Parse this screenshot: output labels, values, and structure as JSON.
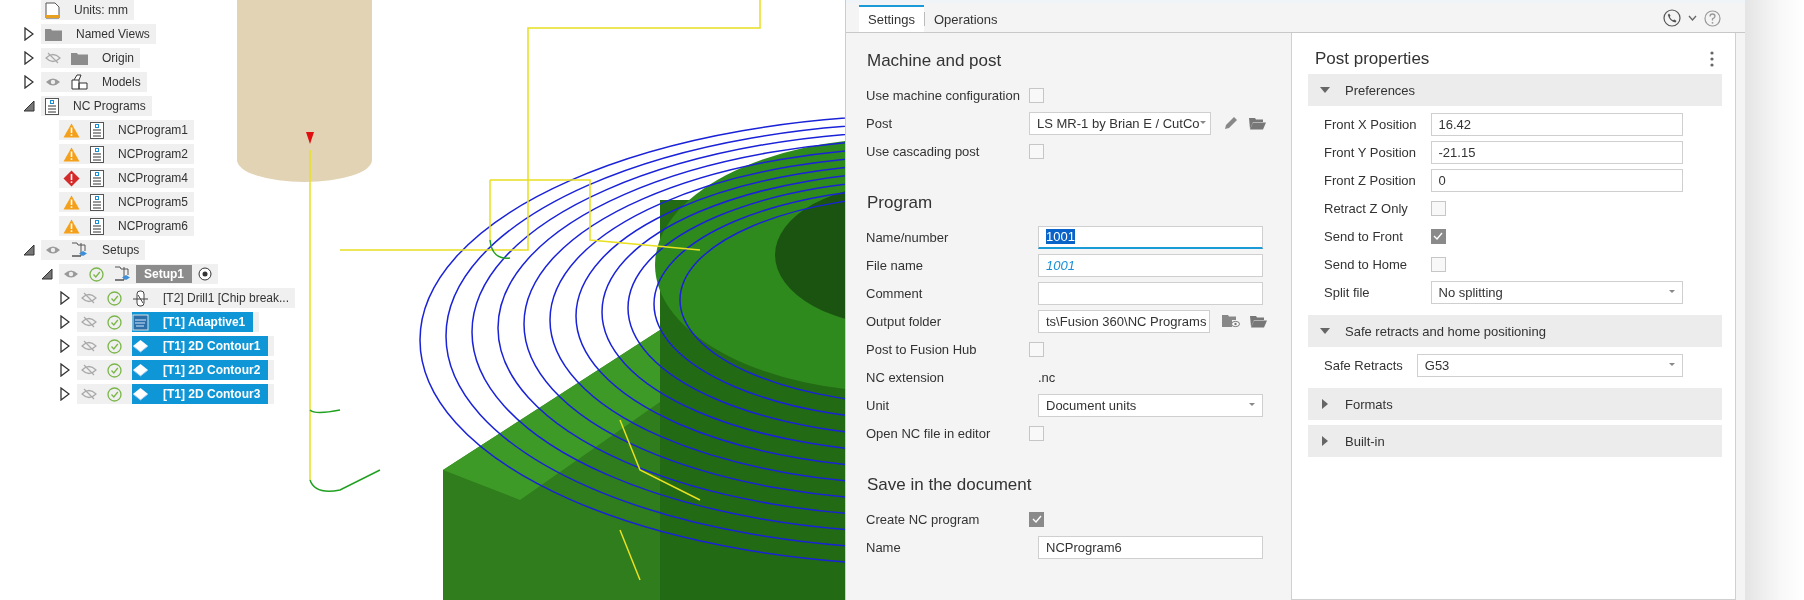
{
  "tree": [
    {
      "label": "Units: mm",
      "kind": "document"
    },
    {
      "label": "Named Views",
      "kind": "folder",
      "expanded": false
    },
    {
      "label": "Origin",
      "kind": "folder",
      "visible": false,
      "expanded": false
    },
    {
      "label": "Models",
      "kind": "model",
      "visible": true,
      "expanded": false
    },
    {
      "label": "NC Programs",
      "kind": "nc-program",
      "expanded": true,
      "children": [
        {
          "label": "NCProgram1",
          "kind": "nc-program",
          "warning": true,
          "error": false
        },
        {
          "label": "NCProgram2",
          "kind": "nc-program",
          "warning": true,
          "error": false
        },
        {
          "label": "NCProgram4",
          "kind": "nc-program",
          "warning": false,
          "error": true
        },
        {
          "label": "NCProgram5",
          "kind": "nc-program",
          "warning": true,
          "error": false
        },
        {
          "label": "NCProgram6",
          "kind": "nc-program",
          "warning": true,
          "error": false
        }
      ]
    },
    {
      "label": "Setups",
      "kind": "setups",
      "visible": true,
      "expanded": true,
      "children": [
        {
          "label": "Setup1",
          "kind": "setups",
          "visible": true,
          "done": true,
          "active": true,
          "expanded": true,
          "children": [
            {
              "label": "[T2] Drill1 [Chip break...",
              "kind": "drill",
              "visible": false,
              "done": true,
              "expanded": false,
              "selected": false
            },
            {
              "label": "[T1] Adaptive1",
              "kind": "adaptive",
              "visible": false,
              "done": true,
              "expanded": false,
              "selected": true
            },
            {
              "label": "[T1] 2D Contour1",
              "kind": "contour",
              "visible": false,
              "done": true,
              "expanded": false,
              "selected": true
            },
            {
              "label": "[T1] 2D Contour2",
              "kind": "contour",
              "visible": false,
              "done": true,
              "expanded": false,
              "selected": true
            },
            {
              "label": "[T1] 2D Contour3",
              "kind": "contour",
              "visible": false,
              "done": true,
              "expanded": false,
              "selected": true
            }
          ]
        }
      ]
    }
  ],
  "dialog": {
    "tabs": [
      {
        "label": "Settings",
        "selected": true
      },
      {
        "label": "Operations",
        "selected": false
      }
    ],
    "sections": [
      {
        "title": "Machine and post",
        "rows": [
          {
            "kind": "checkbox",
            "label": "Use machine configuration",
            "checked": false
          },
          {
            "kind": "post_select",
            "label": "Post",
            "value": "LS MR-1 by Brian E / CutCo"
          },
          {
            "kind": "checkbox",
            "label": "Use cascading post",
            "checked": false
          }
        ]
      },
      {
        "title": "Program",
        "rows": [
          {
            "kind": "input",
            "label": "Name/number",
            "value": "1001",
            "focused": true
          },
          {
            "kind": "input",
            "label": "File name",
            "placeholder": "1001"
          },
          {
            "kind": "input",
            "label": "Comment"
          },
          {
            "kind": "folder_input",
            "label": "Output folder",
            "value": "ts\\Fusion 360\\NC Programs"
          },
          {
            "kind": "checkbox",
            "label": "Post to Fusion Hub",
            "checked": false
          },
          {
            "kind": "static",
            "label": "NC extension",
            "value": ".nc"
          },
          {
            "kind": "select",
            "label": "Unit",
            "value": "Document units"
          },
          {
            "kind": "checkbox",
            "label": "Open NC file in editor",
            "checked": false
          }
        ]
      },
      {
        "title": "Save in the document",
        "rows": [
          {
            "kind": "checkbox",
            "label": "Create NC program",
            "checked": true
          },
          {
            "kind": "input",
            "label": "Name",
            "value": "NCProgram6"
          }
        ]
      }
    ],
    "post_properties": {
      "title": "Post properties",
      "groups": [
        {
          "title": "Preferences",
          "expanded": true,
          "rows": [
            {
              "kind": "input",
              "label": "Front X Position",
              "value": "16.42"
            },
            {
              "kind": "input",
              "label": "Front Y Position",
              "value": "-21.15"
            },
            {
              "kind": "input",
              "label": "Front Z Position",
              "value": "0"
            },
            {
              "kind": "checkbox",
              "label": "Retract Z Only",
              "checked": false
            },
            {
              "kind": "checkbox",
              "label": "Send to Front",
              "checked": true
            },
            {
              "kind": "checkbox",
              "label": "Send to Home",
              "checked": false
            },
            {
              "kind": "select",
              "label": "Split file",
              "value": "No splitting"
            }
          ]
        },
        {
          "title": "Safe retracts and home positioning",
          "expanded": true,
          "rows": [
            {
              "kind": "select",
              "label": "Safe Retracts",
              "value": "G53"
            }
          ]
        },
        {
          "title": "Formats",
          "expanded": false
        },
        {
          "title": "Built-in",
          "expanded": false
        }
      ]
    }
  }
}
